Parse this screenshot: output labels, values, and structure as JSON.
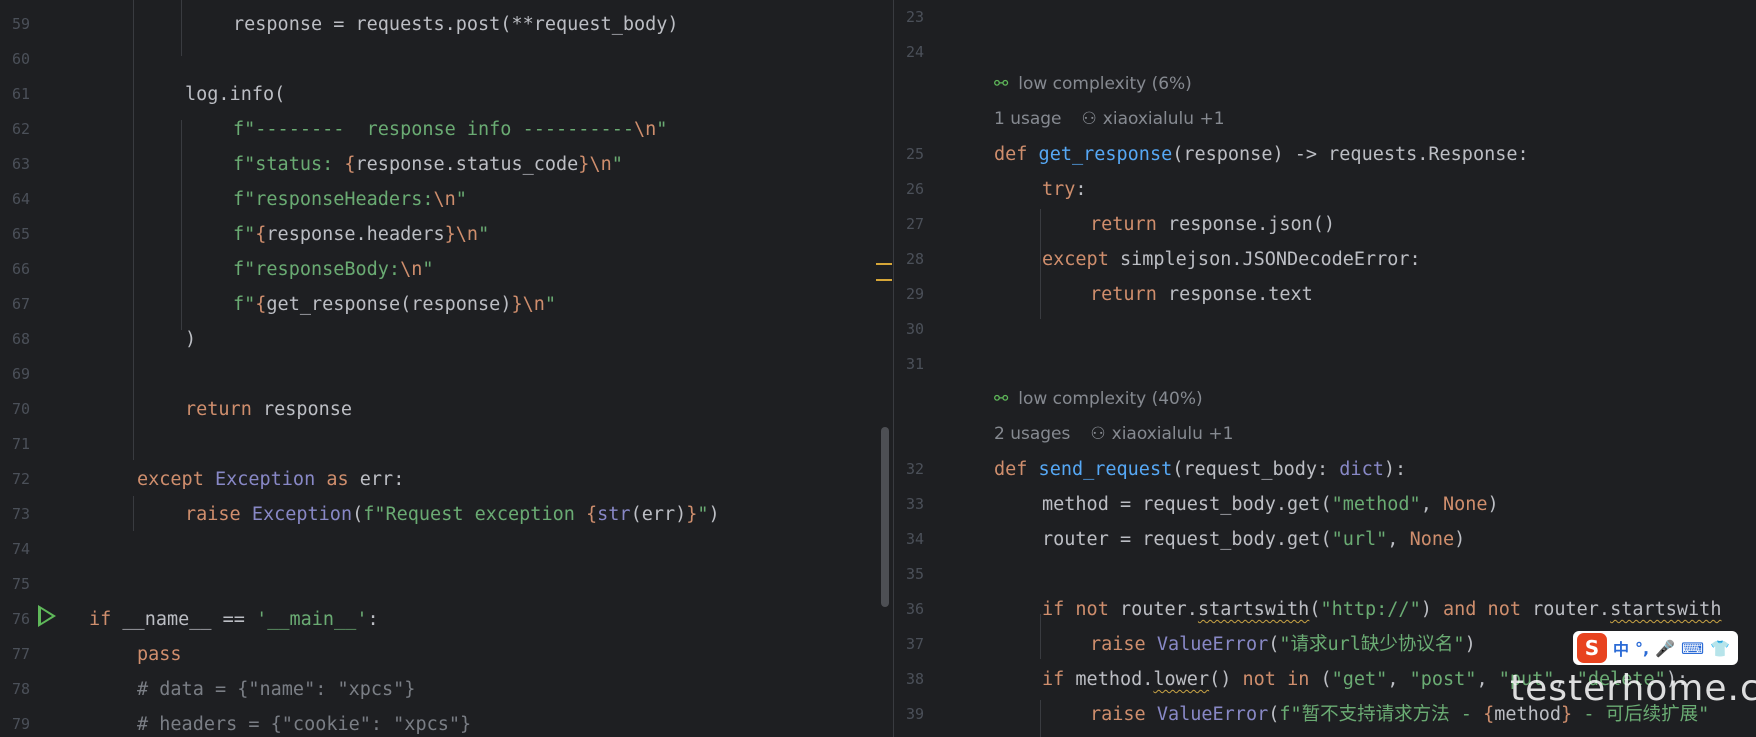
{
  "left": {
    "lines": [
      "59",
      "60",
      "61",
      "62",
      "63",
      "64",
      "65",
      "66",
      "67",
      "68",
      "69",
      "70",
      "71",
      "72",
      "73",
      "74",
      "75",
      "76",
      "77",
      "78",
      "79"
    ],
    "code": {
      "l59_a": "response = requests.post(**request_body)",
      "l61_a": "log.info(",
      "l62_a": "f\"--------  response info ----------",
      "l62_b": "\\n",
      "l62_c": "\"",
      "l63_a": "f\"status: ",
      "l63_b": "{",
      "l63_c": "response.status_code",
      "l63_d": "}",
      "l63_e": "\\n",
      "l63_f": "\"",
      "l64_a": "f\"responseHeaders:",
      "l64_b": "\\n",
      "l64_c": "\"",
      "l65_a": "f\"",
      "l65_b": "{",
      "l65_c": "response.headers",
      "l65_d": "}",
      "l65_e": "\\n",
      "l65_f": "\"",
      "l66_a": "f\"responseBody:",
      "l66_b": "\\n",
      "l66_c": "\"",
      "l67_a": "f\"",
      "l67_b": "{",
      "l67_c": "get_response(response)",
      "l67_d": "}",
      "l67_e": "\\n",
      "l67_f": "\"",
      "l68_a": ")",
      "l70_kw": "return",
      "l70_a": " response",
      "l72_kw": "except",
      "l72_cls": " Exception",
      "l72_kw2": " as",
      "l72_a": " err:",
      "l73_kw": "raise",
      "l73_cls": " Exception",
      "l73_a": "(",
      "l73_s": "f\"Request exception ",
      "l73_b": "{",
      "l73_cls2": "str",
      "l73_c": "(err)",
      "l73_d": "}",
      "l73_s2": "\"",
      "l73_e": ")",
      "l76_kw": "if",
      "l76_a": " __name__ == ",
      "l76_s": "'__main__'",
      "l76_b": ":",
      "l77_kw": "pass",
      "l78_c": "# data = {\"name\": \"xpcs\"}",
      "l79_c": "# headers = {\"cookie\": \"xpcs\"}"
    }
  },
  "right": {
    "lines": [
      "23",
      "24",
      "25",
      "26",
      "27",
      "28",
      "29",
      "30",
      "31",
      "32",
      "33",
      "34",
      "35",
      "36",
      "37",
      "38",
      "39"
    ],
    "hints": {
      "h1_complexity": "low complexity (6%)",
      "h1_usage": "1 usage",
      "h1_author": "xiaoxialulu +1",
      "h2_complexity": "low complexity (40%)",
      "h2_usage": "2 usages",
      "h2_author": "xiaoxialulu +1"
    },
    "code": {
      "r25_kw": "def",
      "r25_fn": " get_response",
      "r25_a": "(response) -> requests.Response:",
      "r26_kw": "try",
      "r26_a": ":",
      "r27_kw": "return",
      "r27_a": " response.json()",
      "r28_kw": "except",
      "r28_a": " simplejson.JSONDecodeError:",
      "r29_kw": "return",
      "r29_a": " response.text",
      "r32_kw": "def",
      "r32_fn": " send_request",
      "r32_a": "(request_body: ",
      "r32_cls": "dict",
      "r32_b": "):",
      "r33_a": "method = request_body.get(",
      "r33_s": "\"method\"",
      "r33_b": ", ",
      "r33_kw": "None",
      "r33_c": ")",
      "r34_a": "router = request_body.get(",
      "r34_s": "\"url\"",
      "r34_b": ", ",
      "r34_kw": "None",
      "r34_c": ")",
      "r36_kw": "if not",
      "r36_a": " router.",
      "r36_sq": "startswith",
      "r36_b": "(",
      "r36_s": "\"http://\"",
      "r36_c": ") ",
      "r36_kw2": "and not",
      "r36_d": " router.",
      "r36_sq2": "startswith",
      "r37_kw": "raise",
      "r37_cls": " ValueError",
      "r37_a": "(",
      "r37_s": "\"请求url缺少协议名\"",
      "r37_b": ")",
      "r38_kw": "if",
      "r38_a": " method.",
      "r38_sq": "lower",
      "r38_b": "() ",
      "r38_kw2": "not in",
      "r38_c": " (",
      "r38_s1": "\"get\"",
      "r38_d": ", ",
      "r38_s2": "\"post\"",
      "r38_e": ", ",
      "r38_s3": "\"put\"",
      "r38_f": ", ",
      "r38_s4": "\"delete\"",
      "r38_g": "):",
      "r39_kw": "raise",
      "r39_cls": " ValueError",
      "r39_a": "(",
      "r39_s": "f\"暂不支持请求方法 - ",
      "r39_b": "{",
      "r39_c": "method",
      "r39_d": "}",
      "r39_s2": " - 可后续扩展\""
    }
  },
  "ime": {
    "logo": "S",
    "items": [
      "中",
      "°,",
      "🎤",
      "⌨",
      "👕"
    ]
  },
  "watermark": "testerhome.com",
  "icons": {
    "run": "run-icon",
    "complexity": "complexity-icon",
    "author": "person-icon"
  },
  "colors": {
    "background": "#1e1f22",
    "keyword": "#cf8e6d",
    "string": "#6aab73",
    "function": "#56a8f5",
    "builtin": "#8888c6",
    "comment": "#7a7e85",
    "run": "#5fb85a"
  }
}
